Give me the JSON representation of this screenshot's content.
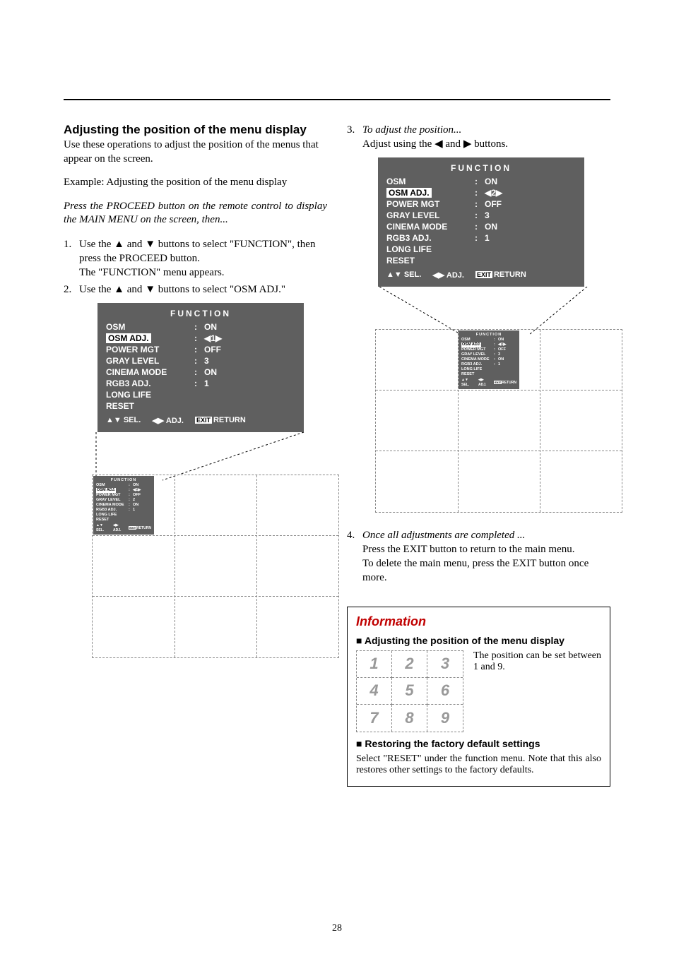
{
  "left": {
    "heading": "Adjusting the position of the menu display",
    "intro": "Use these operations to adjust the position of the menus that appear on the screen.",
    "example": "Example: Adjusting the position of the menu display",
    "press": "Press the PROCEED button on the remote control to display the MAIN MENU on the screen, then...",
    "step1_a": "Use the ",
    "step1_b": " and ",
    "step1_c": " buttons to select \"FUNCTION\", then press the PROCEED button.",
    "step1_d": "The \"FUNCTION\" menu appears.",
    "step2_a": "Use the ",
    "step2_b": " and ",
    "step2_c": " buttons to select \"OSM ADJ.\""
  },
  "right": {
    "step3_label": "To adjust the position...",
    "step3_a": "Adjust using the ",
    "step3_b": " and ",
    "step3_c": " buttons.",
    "step4_label": "Once all adjustments are completed ...",
    "step4_a": "Press the EXIT button to return to the main menu.",
    "step4_b": "To delete the main menu, press the EXIT button once more."
  },
  "osd": {
    "title": "FUNCTION",
    "rows": [
      {
        "label": "OSM",
        "val": "ON"
      },
      {
        "label": "OSM ADJ.",
        "boxed": true
      },
      {
        "label": "POWER MGT",
        "val": "OFF"
      },
      {
        "label": "GRAY LEVEL",
        "val": "3"
      },
      {
        "label": "CINEMA MODE",
        "val": "ON"
      },
      {
        "label": "RGB3 ADJ.",
        "val": "1"
      },
      {
        "label": "LONG LIFE"
      },
      {
        "label": "RESET"
      }
    ],
    "adj_left": "1",
    "adj_right": "2",
    "footer_sel": "SEL.",
    "footer_adj": "ADJ.",
    "footer_exit": "EXIT",
    "footer_return": "RETURN"
  },
  "tiny_adj_left": "1",
  "tiny_adj_right": "1",
  "info": {
    "title": "Information",
    "sub1": "Adjusting the position of the menu display",
    "desc": "The position can be set between 1 and 9.",
    "grid": [
      "1",
      "2",
      "3",
      "4",
      "5",
      "6",
      "7",
      "8",
      "9"
    ],
    "sub2": "Restoring the factory default settings",
    "restore": "Select \"RESET\" under the function menu. Note that this also restores other settings to the factory defaults."
  },
  "page_number": "28"
}
